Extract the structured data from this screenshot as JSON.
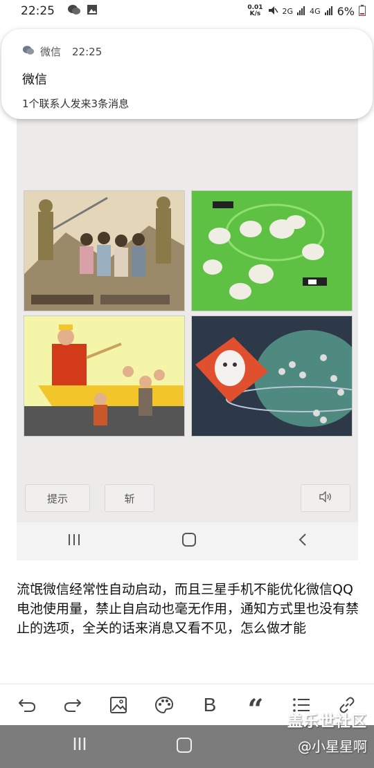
{
  "status_bar": {
    "time": "22:25",
    "net_speed_value": "0.01",
    "net_speed_unit": "K/s",
    "battery": "6%",
    "signal_labels": [
      "2G",
      "4G"
    ]
  },
  "notification": {
    "app": "微信",
    "time": "22:25",
    "title": "微信",
    "body": "1个联系人发来3条消息"
  },
  "embedded_screenshot": {
    "buttons": {
      "hint": "提示",
      "cut": "斩"
    }
  },
  "post": {
    "text": "流氓微信经常性自动启动，而且三星手机不能优化微信QQ电池使用量，禁止自启动也毫无作用，通知方式里也没有禁止的选项，全关的话来消息又看不见，怎么做才能"
  },
  "toolbar": {
    "icons": [
      "undo-icon",
      "redo-icon",
      "image-icon",
      "palette-icon",
      "bold-icon",
      "quote-icon",
      "list-icon",
      "link-icon"
    ],
    "bold_label": "B",
    "quote_label": "“"
  },
  "watermark": {
    "line1": "盖乐世社区",
    "line2": "@小星星啊"
  },
  "colors": {
    "nav_bar": "#7c7c7c",
    "panel_green": "#63c545",
    "panel_yellow": "#f4f5a8",
    "panel_dark": "#2d3848"
  }
}
